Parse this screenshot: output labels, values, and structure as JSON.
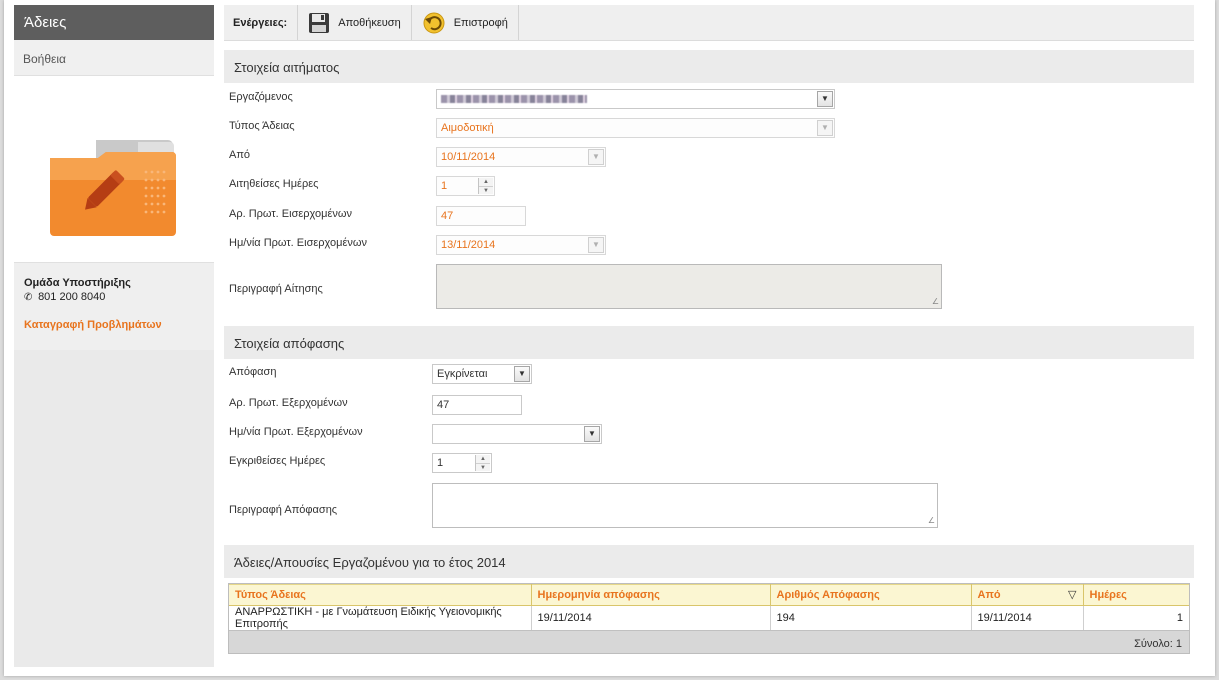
{
  "sidebar": {
    "title": "Άδειες",
    "help": "Βοήθεια",
    "support_title": "Ομάδα Υποστήριξης",
    "support_phone": "801 200 8040",
    "support_link": "Καταγραφή Προβλημάτων"
  },
  "toolbar": {
    "label": "Ενέργειες:",
    "save": "Αποθήκευση",
    "back": "Επιστροφή"
  },
  "request": {
    "header": "Στοιχεία αιτήματος",
    "employee_label": "Εργαζόμενος",
    "leave_type_label": "Τύπος Άδειας",
    "leave_type_value": "Αιμοδοτική",
    "from_label": "Από",
    "from_value": "10/11/2014",
    "days_label": "Αιτηθείσες Ημέρες",
    "days_value": "1",
    "in_protocol_label": "Αρ. Πρωτ. Εισερχομένων",
    "in_protocol_value": "47",
    "in_protocol_date_label": "Ημ/νία Πρωτ. Εισερχομένων",
    "in_protocol_date_value": "13/11/2014",
    "description_label": "Περιγραφή Αίτησης"
  },
  "decision": {
    "header": "Στοιχεία απόφασης",
    "decision_label": "Απόφαση",
    "decision_value": "Εγκρίνεται",
    "out_protocol_label": "Αρ. Πρωτ. Εξερχομένων",
    "out_protocol_value": "47",
    "out_protocol_date_label": "Ημ/νία Πρωτ. Εξερχομένων",
    "approved_days_label": "Εγκριθείσες Ημέρες",
    "approved_days_value": "1",
    "description_label": "Περιγραφή Απόφασης"
  },
  "history": {
    "header": "Άδειες/Απουσίες Εργαζομένου για το έτος 2014",
    "columns": [
      "Τύπος Άδειας",
      "Ημερομηνία απόφασης",
      "Αριθμός Απόφασης",
      "Από",
      "Ημέρες"
    ],
    "rows": [
      [
        "ΑΝΑΡΡΩΣΤΙΚΗ - με Γνωμάτευση Ειδικής Υγειονομικής Επιτροπής",
        "19/11/2014",
        "194",
        "19/11/2014",
        "1"
      ]
    ],
    "total": "Σύνολο: 1"
  },
  "colors": {
    "accent": "#e8741e",
    "header_bg": "#ebebeb",
    "sidebar_title_bg": "#5e5e5e"
  }
}
